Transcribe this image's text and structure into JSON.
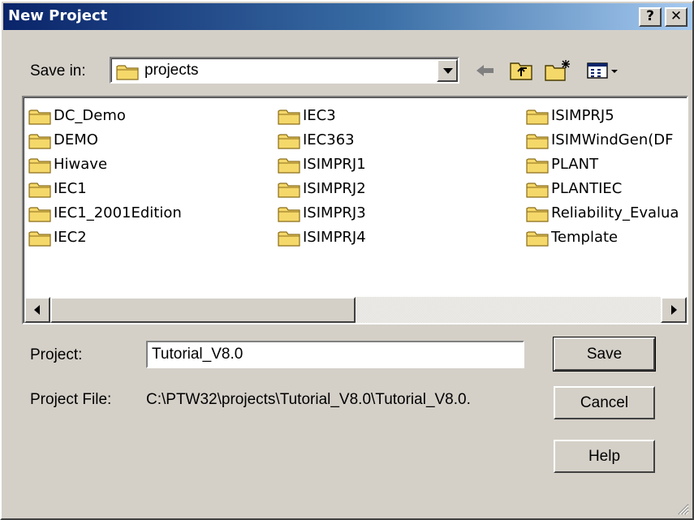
{
  "window": {
    "title": "New Project",
    "help_label": "?",
    "close_label": "✕"
  },
  "save_in": {
    "label": "Save in:",
    "value": "projects"
  },
  "toolbar": {
    "icons": [
      "back-arrow-icon",
      "up-folder-icon",
      "new-folder-icon",
      "view-menu-icon"
    ]
  },
  "folders": [
    {
      "name": "DC_Demo"
    },
    {
      "name": "DEMO"
    },
    {
      "name": "Hiwave"
    },
    {
      "name": "IEC1"
    },
    {
      "name": "IEC1_2001Edition"
    },
    {
      "name": "IEC2"
    },
    {
      "name": "IEC3"
    },
    {
      "name": "IEC363"
    },
    {
      "name": "ISIMPRJ1"
    },
    {
      "name": "ISIMPRJ2"
    },
    {
      "name": "ISIMPRJ3"
    },
    {
      "name": "ISIMPRJ4"
    },
    {
      "name": "ISIMPRJ5"
    },
    {
      "name": "ISIMWindGen(DF"
    },
    {
      "name": "PLANT"
    },
    {
      "name": "PLANTIEC"
    },
    {
      "name": "Reliability_Evalua"
    },
    {
      "name": "Template"
    }
  ],
  "project": {
    "label": "Project:",
    "value": "Tutorial_V8.0"
  },
  "project_file": {
    "label": "Project File:",
    "value": "C:\\PTW32\\projects\\Tutorial_V8.0\\Tutorial_V8.0."
  },
  "buttons": {
    "save": "Save",
    "cancel": "Cancel",
    "help": "Help"
  },
  "colors": {
    "face": "#d4d0c8",
    "title_start": "#0a246a",
    "title_end": "#a6caf0",
    "folder": "#f5d86a"
  }
}
